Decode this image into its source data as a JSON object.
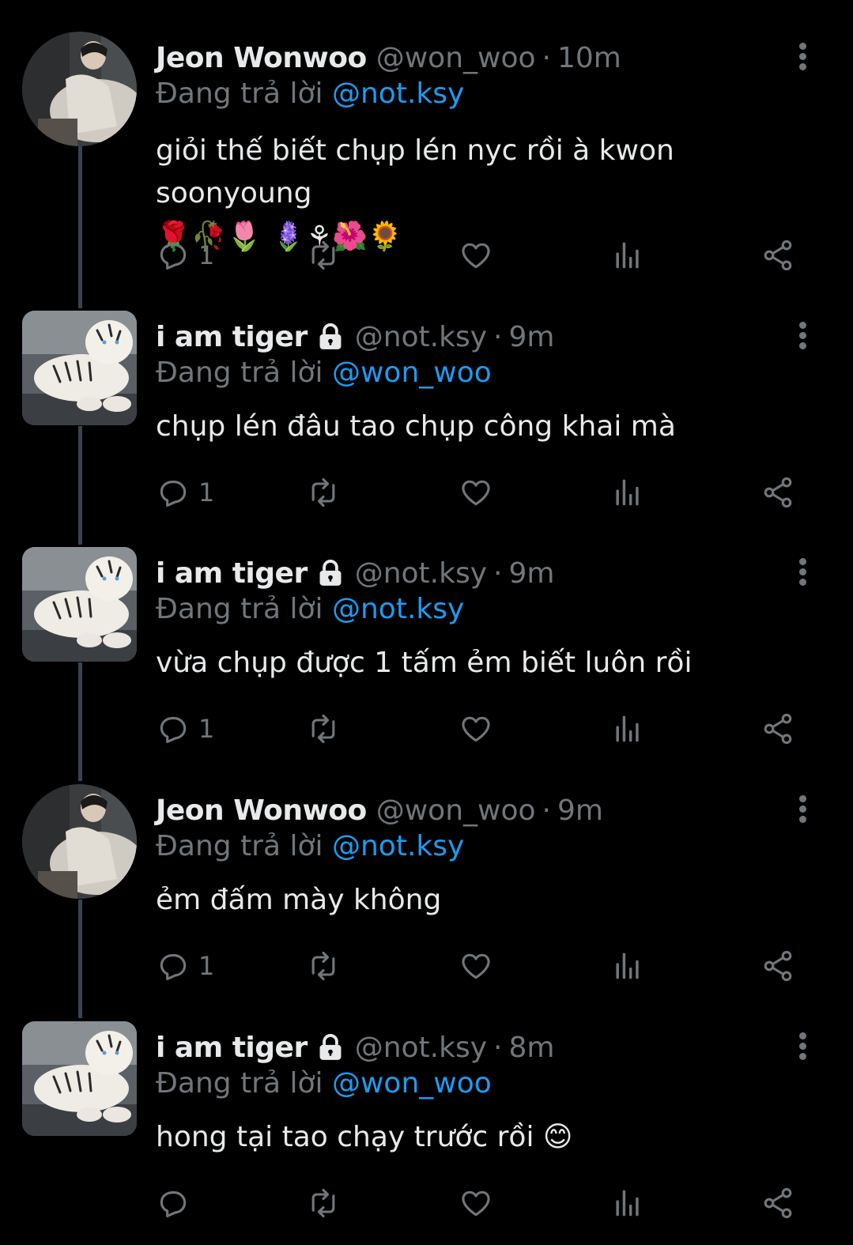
{
  "tweets": [
    {
      "name": "Jeon Wonwoo",
      "handle": "@won_woo",
      "sep": "·",
      "time": "10m",
      "locked": false,
      "avatar": "person-avatar",
      "reply_prefix": "Đang trả lời",
      "reply_to": "@not.ksy",
      "text": "giỏi thế biết chụp lén nyc rồi à kwon soonyoung",
      "emojis": "🌹🥀🌷 🪻⚘🌺🌻",
      "reply_count": "1"
    },
    {
      "name": "i am tiger",
      "handle": "@not.ksy",
      "sep": "·",
      "time": "9m",
      "locked": true,
      "avatar": "tiger-avatar",
      "reply_prefix": "Đang trả lời",
      "reply_to": "@won_woo",
      "text": "chụp lén đâu tao chụp công khai mà",
      "emojis": "",
      "reply_count": "1"
    },
    {
      "name": "i am tiger",
      "handle": "@not.ksy",
      "sep": "·",
      "time": "9m",
      "locked": true,
      "avatar": "tiger-avatar",
      "reply_prefix": "Đang trả lời",
      "reply_to": "@not.ksy",
      "text": "vừa chụp được 1 tấm ẻm biết luôn rồi",
      "emojis": "",
      "reply_count": "1"
    },
    {
      "name": "Jeon Wonwoo",
      "handle": "@won_woo",
      "sep": "·",
      "time": "9m",
      "locked": false,
      "avatar": "person-avatar",
      "reply_prefix": "Đang trả lời",
      "reply_to": "@not.ksy",
      "text": "ẻm đấm mày không",
      "emojis": "",
      "reply_count": "1"
    },
    {
      "name": "i am tiger",
      "handle": "@not.ksy",
      "sep": "·",
      "time": "8m",
      "locked": true,
      "avatar": "tiger-avatar",
      "reply_prefix": "Đang trả lời",
      "reply_to": "@won_woo",
      "text": "hong tại tao chạy trước rồi 😊",
      "emojis": "",
      "reply_count": ""
    }
  ],
  "icons": {
    "reply": "reply-icon",
    "retweet": "retweet-icon",
    "like": "heart-icon",
    "views": "views-icon",
    "share": "share-icon",
    "more": "more-icon",
    "lock": "lock-icon"
  },
  "colors": {
    "background": "#000000",
    "text": "#e7e9ea",
    "muted": "#71767b",
    "link": "#1d9bf0",
    "thread_line": "#38444d"
  }
}
